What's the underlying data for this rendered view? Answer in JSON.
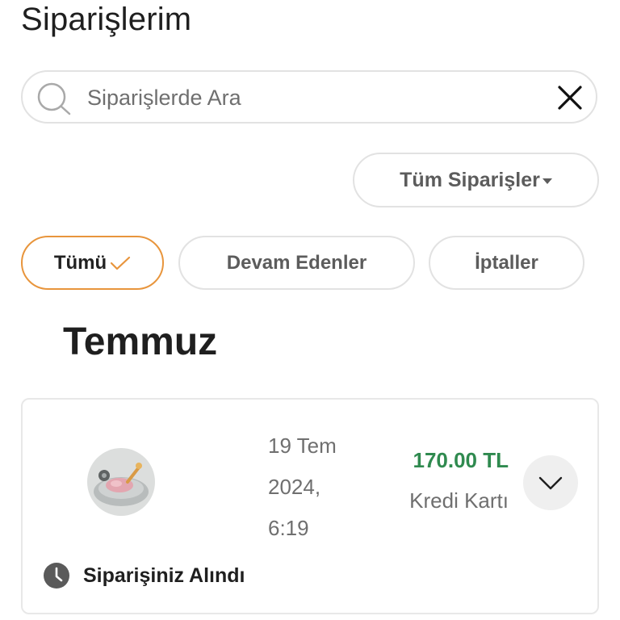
{
  "header": {
    "title": "Siparişlerim"
  },
  "search": {
    "placeholder": "Siparişlerde Ara",
    "value": ""
  },
  "filter": {
    "dropdown_label": "Tüm Siparişler"
  },
  "tabs": [
    {
      "label": "Tümü",
      "selected": true
    },
    {
      "label": "Devam Edenler",
      "selected": false
    },
    {
      "label": "İptaller",
      "selected": false
    }
  ],
  "orders_section": {
    "month": "Temmuz",
    "orders": [
      {
        "date_line1": "19 Tem",
        "date_line2": "2024,",
        "date_line3": "6:19",
        "amount": "170.00 TL",
        "payment_method": "Kredi Kartı",
        "status": "Siparişiniz Alındı"
      }
    ]
  },
  "colors": {
    "accent_orange": "#e8953c",
    "amount_green": "#2f8a4f",
    "border_gray": "#e2e2e2",
    "muted_text": "#6f6f6f"
  },
  "icons": [
    "search-icon",
    "close-icon",
    "caret-down-icon",
    "check-icon",
    "chevron-down-icon",
    "clock-icon"
  ]
}
